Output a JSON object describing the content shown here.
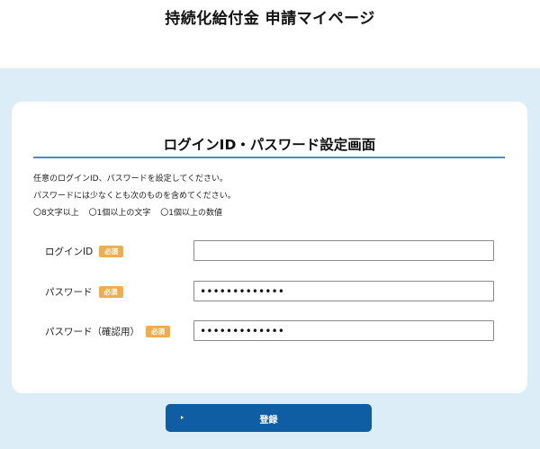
{
  "header": {
    "title": "持続化給付金 申請マイページ"
  },
  "card": {
    "title": "ログインID・パスワード設定画面",
    "instructions": {
      "line1": "任意のログインID、パスワードを設定してください。",
      "line2": "パスワードには少なくとも次のものを含めてください。",
      "requirements": [
        "〇8文字以上",
        "〇1個以上の文字",
        "〇1個以上の数値"
      ]
    },
    "required_label": "必須",
    "fields": {
      "login_id": {
        "label": "ログインID",
        "value": ""
      },
      "password": {
        "label": "パスワード",
        "value": "•••••••••••••"
      },
      "password_confirm": {
        "label": "パスワード（確認用）",
        "value": "•••••••••••••"
      }
    }
  },
  "submit": {
    "label": "登録"
  },
  "colors": {
    "page_background": "#dcedf7",
    "title_rule": "#4f8fb7",
    "required_badge": "#f0ad4e",
    "submit_button": "#0f5ea3"
  }
}
